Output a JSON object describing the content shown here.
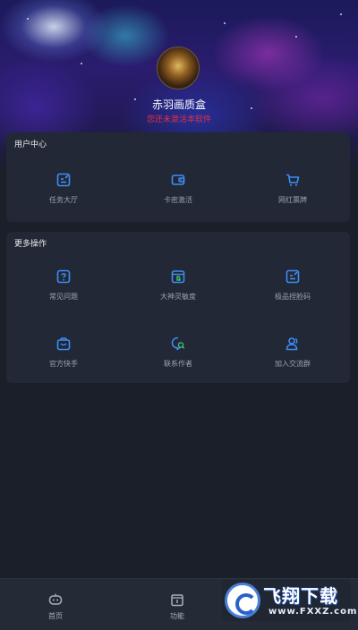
{
  "header": {
    "app_name": "赤羽画质盒",
    "warning": "您还未激活本软件"
  },
  "user_center": {
    "title": "用户中心",
    "items": [
      {
        "label": "任务大厅",
        "icon": "edit-icon"
      },
      {
        "label": "卡密激活",
        "icon": "wallet-icon"
      },
      {
        "label": "网红票牌",
        "icon": "cart-icon"
      }
    ]
  },
  "more_ops": {
    "title": "更多操作",
    "items": [
      {
        "label": "常见问题",
        "icon": "question-icon"
      },
      {
        "label": "大神灵敏度",
        "icon": "calendar-g-icon"
      },
      {
        "label": "极品捏脸码",
        "icon": "edit-icon"
      },
      {
        "label": "官方快手",
        "icon": "bag-icon"
      },
      {
        "label": "联系作者",
        "icon": "chat-search-icon"
      },
      {
        "label": "加入交流群",
        "icon": "users-icon"
      }
    ]
  },
  "tabbar": {
    "items": [
      {
        "label": "首页",
        "icon": "robot-icon"
      },
      {
        "label": "功能",
        "icon": "box-icon"
      }
    ]
  },
  "watermark": {
    "main": "飞翔下载",
    "sub": "www.FXXZ.com"
  },
  "colors": {
    "accent": "#3d8df5",
    "warning": "#e0323a",
    "card": "#222835",
    "background": "#1a1f2a"
  }
}
